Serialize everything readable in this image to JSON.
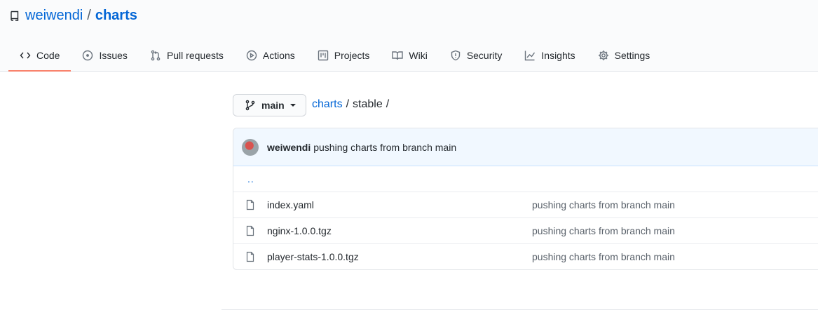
{
  "repo": {
    "owner": "weiwendi",
    "separator": "/",
    "name": "charts"
  },
  "tabs": [
    {
      "label": "Code",
      "icon": "code-icon",
      "selected": true
    },
    {
      "label": "Issues",
      "icon": "issue-icon"
    },
    {
      "label": "Pull requests",
      "icon": "pull-request-icon"
    },
    {
      "label": "Actions",
      "icon": "play-icon"
    },
    {
      "label": "Projects",
      "icon": "project-icon"
    },
    {
      "label": "Wiki",
      "icon": "book-icon"
    },
    {
      "label": "Security",
      "icon": "shield-icon"
    },
    {
      "label": "Insights",
      "icon": "graph-icon"
    },
    {
      "label": "Settings",
      "icon": "gear-icon"
    }
  ],
  "branch": {
    "label": "main"
  },
  "breadcrumb": {
    "root": "charts",
    "sep1": "/",
    "current": "stable",
    "sep2": "/"
  },
  "commit": {
    "author": "weiwendi",
    "message": "pushing charts from branch main"
  },
  "files": {
    "up": "..",
    "items": [
      {
        "name": "index.yaml",
        "message": "pushing charts from branch main"
      },
      {
        "name": "nginx-1.0.0.tgz",
        "message": "pushing charts from branch main"
      },
      {
        "name": "player-stats-1.0.0.tgz",
        "message": "pushing charts from branch main"
      }
    ]
  },
  "colors": {
    "link": "#0366d6",
    "tab_underline": "#f9826c",
    "commit_bar": "#f1f8ff"
  }
}
